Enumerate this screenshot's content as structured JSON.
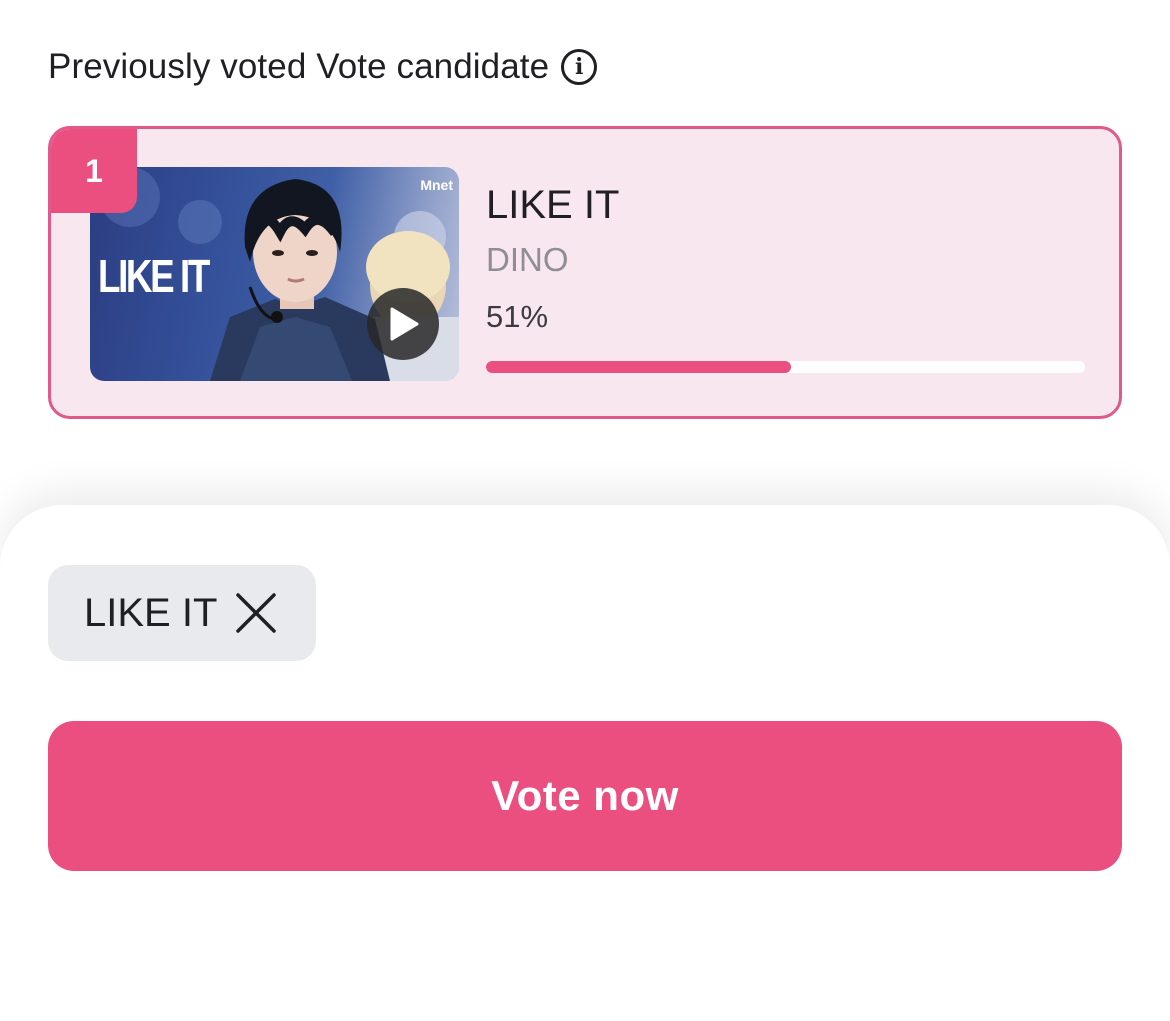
{
  "section": {
    "title": "Previously voted Vote candidate",
    "info_icon": "info-icon"
  },
  "candidates": [
    {
      "rank": "1",
      "thumbnail_text": "LIKE IT",
      "thumbnail_logo": "Mnet",
      "title": "LIKE IT",
      "artist": "DINO",
      "percent_label": "51%",
      "percent": 51
    }
  ],
  "selected_chip": {
    "label": "LIKE IT",
    "remove_icon": "close-icon"
  },
  "vote_button": {
    "label": "Vote now"
  },
  "colors": {
    "accent": "#ea4f80",
    "card_background": "#f8e7ef",
    "card_border": "#e0598a",
    "chip_background": "#e9eaee"
  }
}
